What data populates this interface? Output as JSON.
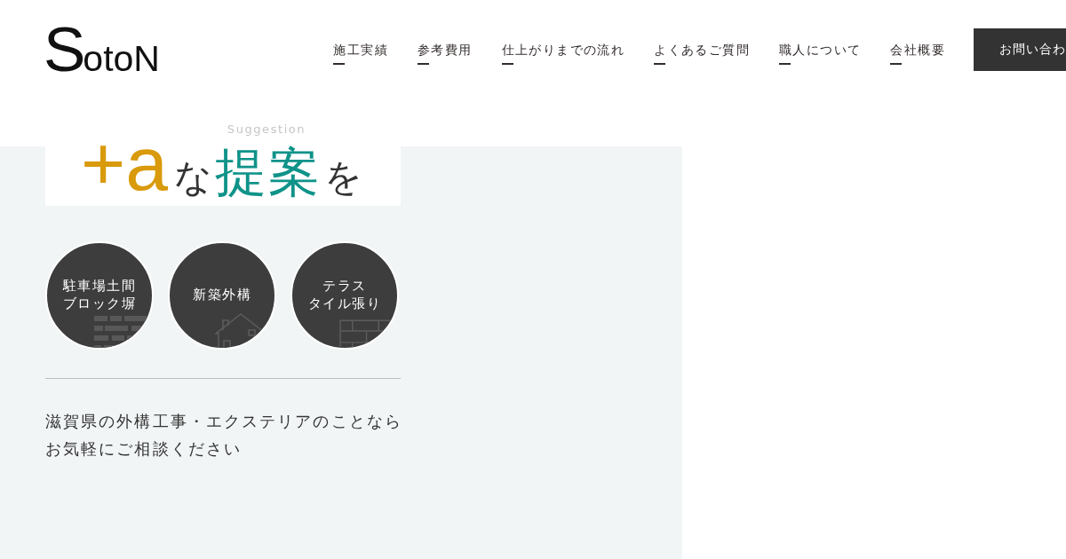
{
  "header": {
    "logo": [
      {
        "text": "S",
        "kind": "initial"
      },
      {
        "text": "otoN",
        "kind": "rest"
      }
    ],
    "nav": [
      "施工実績",
      "参考費用",
      "仕上がりまでの流れ",
      "よくあるご質問",
      "職人について",
      "会社概要"
    ],
    "contact_button": "お問い合わ"
  },
  "section": {
    "subtitle": "Suggestion",
    "heading": [
      {
        "text": "+a",
        "kind": "accent"
      },
      {
        "text": "な",
        "kind": "plain"
      },
      {
        "text": "提案",
        "kind": "highlight"
      },
      {
        "text": "を",
        "kind": "plain"
      }
    ],
    "categories": [
      {
        "lines": [
          "駐車場土間",
          "ブロック塀"
        ],
        "kind": "bricks"
      },
      {
        "lines": [
          "新築外構"
        ],
        "kind": "house"
      },
      {
        "lines": [
          "テラス",
          "タイル張り"
        ],
        "kind": "tiles"
      }
    ],
    "description": [
      "滋賀県の外構工事・エクステリアのことなら",
      "お気軽にご相談ください"
    ]
  }
}
